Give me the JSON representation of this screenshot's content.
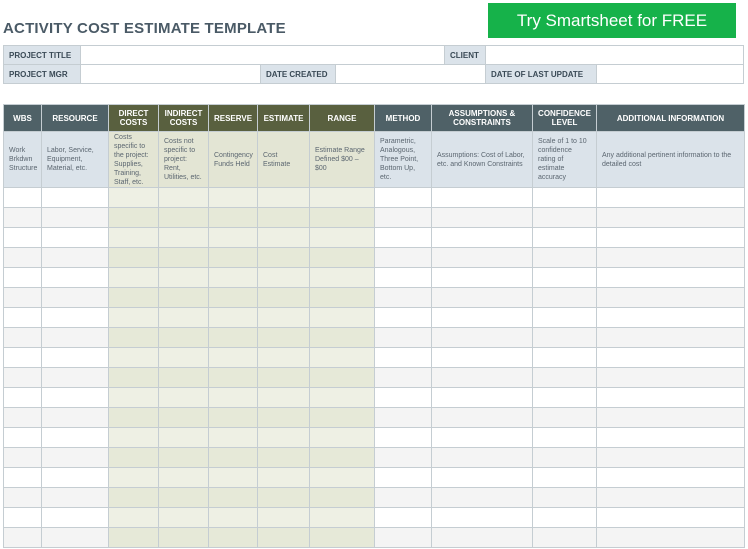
{
  "title": "ACTIVITY COST ESTIMATE TEMPLATE",
  "cta_label": "Try Smartsheet for FREE",
  "info": {
    "project_title_label": "PROJECT TITLE",
    "client_label": "CLIENT",
    "project_mgr_label": "PROJECT MGR",
    "date_created_label": "DATE CREATED",
    "last_update_label": "DATE OF LAST UPDATE"
  },
  "columns": [
    {
      "header": "WBS",
      "desc": "Work Brkdwn Structure"
    },
    {
      "header": "RESOURCE",
      "desc": "Labor, Service, Equipment, Material, etc."
    },
    {
      "header": "DIRECT COSTS",
      "desc": "Costs specific to the project: Supplies, Training, Staff, etc."
    },
    {
      "header": "INDIRECT COSTS",
      "desc": "Costs not specific to project: Rent, Utilities, etc."
    },
    {
      "header": "RESERVE",
      "desc": "Contingency Funds Held"
    },
    {
      "header": "ESTIMATE",
      "desc": "Cost Estimate"
    },
    {
      "header": "RANGE",
      "desc": "Estimate Range Defined $00 – $00"
    },
    {
      "header": "METHOD",
      "desc": "Parametric, Analogous, Three Point, Bottom Up, etc."
    },
    {
      "header": "ASSUMPTIONS & CONSTRAINTS",
      "desc": "Assumptions: Cost of Labor, etc. and Known Constraints"
    },
    {
      "header": "CONFIDENCE LEVEL",
      "desc": "Scale of 1 to 10 confidence rating of estimate accuracy"
    },
    {
      "header": "ADDITIONAL INFORMATION",
      "desc": "Any additional pertinent information to the detailed cost"
    }
  ]
}
